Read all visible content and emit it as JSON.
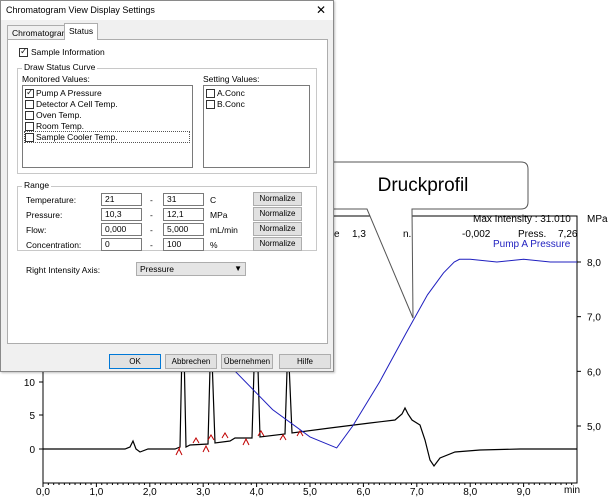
{
  "dialog": {
    "title": "Chromatogram View Display Settings",
    "close_glyph": "✕",
    "tabs": [
      {
        "label": "Chromatogram"
      },
      {
        "label": "Status"
      }
    ],
    "sample_information": {
      "label": "Sample Information",
      "checked": true
    },
    "draw_group_title": "Draw Status Curve",
    "monitored_label": "Monitored Values:",
    "setting_label": "Setting Values:",
    "monitored": [
      {
        "label": "Pump A Pressure",
        "checked": true
      },
      {
        "label": "Detector A Cell Temp.",
        "checked": false
      },
      {
        "label": "Oven Temp.",
        "checked": false
      },
      {
        "label": "Room Temp.",
        "checked": false
      },
      {
        "label": "Sample Cooler Temp.",
        "checked": false
      }
    ],
    "setting": [
      {
        "label": "A.Conc",
        "checked": false
      },
      {
        "label": "B.Conc",
        "checked": false
      }
    ],
    "range_title": "Range",
    "range_rows": [
      {
        "label": "Temperature:",
        "min": "21",
        "max": "31",
        "unit": "C",
        "button": "Normalize"
      },
      {
        "label": "Pressure:",
        "min": "10,3",
        "max": "12,1",
        "unit": "MPa",
        "button": "Normalize"
      },
      {
        "label": "Flow:",
        "min": "0,000",
        "max": "5,000",
        "unit": "mL/min",
        "button": "Normalize"
      },
      {
        "label": "Concentration:",
        "min": "0",
        "max": "100",
        "unit": "%",
        "button": "Normalize"
      }
    ],
    "range_dash": "-",
    "right_axis_label": "Right Intensity Axis:",
    "right_axis_value": "Pressure",
    "buttons": {
      "ok": "OK",
      "cancel": "Abbrechen",
      "apply": "Übernehmen",
      "help": "Hilfe"
    }
  },
  "callout": {
    "text": "Druckprofil"
  },
  "chromatogram": {
    "max_intensity_label": "Max Intensity : 31.010",
    "right_unit": "MPa",
    "series_label": "Pump A Pressure",
    "series_color": "#1f1fbf",
    "info_fragments": [
      "e",
      "1,3",
      "n.",
      "-0,002",
      "Press.",
      "7,26"
    ],
    "x_unit": "min"
  },
  "chart_data": {
    "type": "line",
    "x_ticks": [
      "0,0",
      "1,0",
      "2,0",
      "3,0",
      "4,0",
      "5,0",
      "6,0",
      "7,0",
      "8,0",
      "9,0"
    ],
    "left_ticks": [
      "10",
      "5",
      "0"
    ],
    "right_ticks": [
      "8,0",
      "7,0",
      "6,0",
      "5,0"
    ],
    "xlim": [
      0,
      10
    ],
    "series": [
      {
        "name": "Pump A Pressure",
        "axis": "right",
        "x": [
          2.7,
          3.6,
          4.3,
          5.0,
          5.5,
          5.8,
          6.3,
          6.8,
          7.2,
          7.5,
          7.7,
          7.8,
          8.0,
          8.5,
          9.0,
          9.5,
          10.0
        ],
        "y": [
          6.9,
          6.0,
          5.3,
          4.8,
          4.6,
          5.0,
          5.8,
          6.7,
          7.4,
          7.8,
          8.0,
          8.05,
          8.05,
          8.0,
          8.05,
          8.0,
          8.0
        ]
      }
    ]
  }
}
